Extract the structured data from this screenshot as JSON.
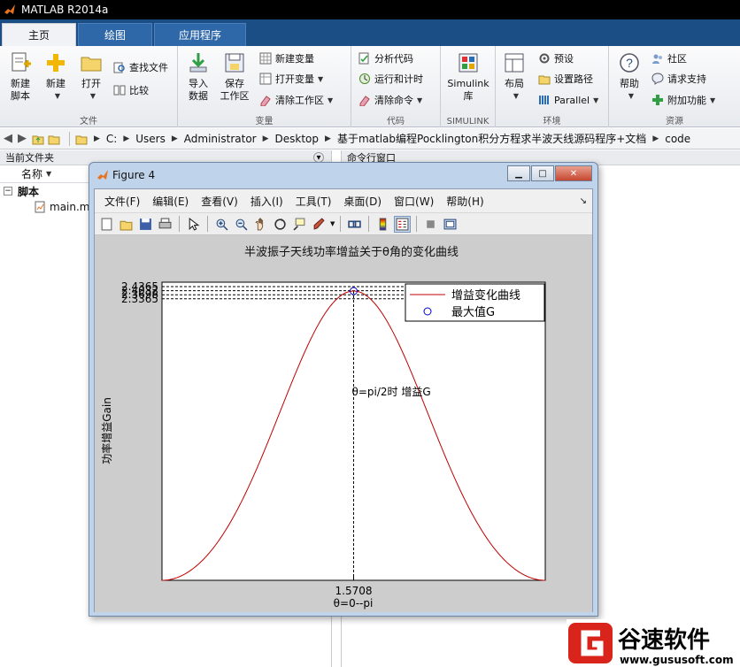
{
  "app": {
    "title": "MATLAB R2014a"
  },
  "tabs": [
    {
      "label": "主页",
      "active": true
    },
    {
      "label": "绘图",
      "active": false
    },
    {
      "label": "应用程序",
      "active": false
    }
  ],
  "ribbon": {
    "file": {
      "label": "文件",
      "new_script": "新建\n脚本",
      "new": "新建",
      "open": "打开",
      "find_files": "查找文件",
      "compare": "比较"
    },
    "variable": {
      "label": "变量",
      "import": "导入\n数据",
      "save_ws": "保存\n工作区",
      "new_var": "新建变量",
      "open_var": "打开变量",
      "clear_ws": "清除工作区"
    },
    "code": {
      "label": "代码",
      "analyze": "分析代码",
      "run_time": "运行和计时",
      "clear_cmd": "清除命令"
    },
    "simulink": {
      "label": "SIMULINK",
      "lib": "Simulink\n库"
    },
    "env": {
      "label": "环境",
      "layout": "布局",
      "prefs": "预设",
      "set_path": "设置路径",
      "parallel": "Parallel"
    },
    "resources": {
      "label": "资源",
      "help": "帮助",
      "community": "社区",
      "support": "请求支持",
      "addons": "附加功能"
    }
  },
  "address": {
    "crumbs": [
      "C:",
      "Users",
      "Administrator",
      "Desktop",
      "基于matlab编程Pocklington积分方程求半波天线源码程序+文档",
      "code"
    ]
  },
  "left_panel": {
    "title": "当前文件夹",
    "col_name": "名称",
    "folder": "脚本",
    "file": "main.m"
  },
  "right_panel": {
    "title": "命令行窗口"
  },
  "figure": {
    "title": "Figure 4",
    "menu": [
      "文件(F)",
      "编辑(E)",
      "查看(V)",
      "插入(I)",
      "工具(T)",
      "桌面(D)",
      "窗口(W)",
      "帮助(H)"
    ],
    "toolbar_icons": [
      "new-figure-icon",
      "open-file-icon",
      "save-icon",
      "print-icon",
      "pointer-icon",
      "zoom-in-icon",
      "zoom-out-icon",
      "pan-icon",
      "rotate-icon",
      "data-cursor-icon",
      "brush-icon",
      "link-icon",
      "colorbar-icon",
      "legend-icon",
      "hide-tools-icon",
      "show-tools-icon"
    ]
  },
  "chart_data": {
    "type": "line",
    "title": "半波振子天线功率增益关于θ角的变化曲线",
    "xlabel": "θ=0--pi",
    "ylabel": "功率增益Gain",
    "xlim": [
      0,
      3.1416
    ],
    "x_ticks": [
      1.5708
    ],
    "x_tick_labels": [
      "1.5708"
    ],
    "ylim": [
      0,
      2.4365
    ],
    "y_ticks": [
      2.3365,
      2.3698,
      2.4032,
      2.4365
    ],
    "y_tick_labels": [
      "2.3365",
      "2.3698",
      "2.4032",
      "2.4365"
    ],
    "series": [
      {
        "name": "增益变化曲线",
        "color": "#c00000",
        "style": "line"
      },
      {
        "name": "最大值G",
        "color": "#0000cc",
        "style": "marker-circle"
      }
    ],
    "max_point": {
      "x": 1.5708,
      "y": 2.4365
    },
    "annotation": "θ=pi/2时 增益G",
    "legend_position": "top-right"
  }
}
